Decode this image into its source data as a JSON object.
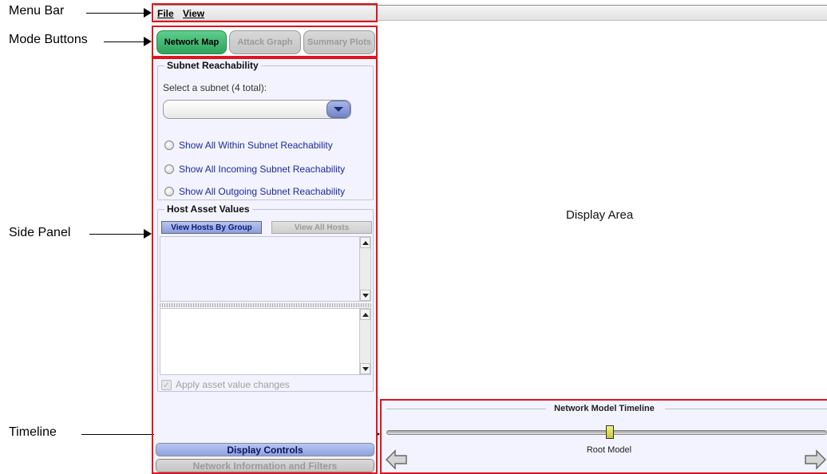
{
  "annotations": {
    "menu_bar": "Menu Bar",
    "mode_buttons": "Mode Buttons",
    "side_panel": "Side Panel",
    "timeline": "Timeline",
    "display_area": "Display Area"
  },
  "menu": {
    "file": "File",
    "view": "View"
  },
  "modes": {
    "network_map": "Network Map",
    "attack_graph": "Attack Graph",
    "summary_plots": "Summary Plots"
  },
  "subnet": {
    "title": "Subnet Reachability",
    "select_label": "Select a subnet (4 total):",
    "selected_value": "",
    "options": [
      "Show All Within Subnet Reachability",
      "Show All Incoming Subnet Reachability",
      "Show All Outgoing Subnet Reachability"
    ]
  },
  "host_assets": {
    "title": "Host Asset Values",
    "view_by_group": "View Hosts By Group",
    "view_all": "View All Hosts",
    "apply_label": "Apply asset value changes"
  },
  "side_buttons": {
    "display_controls": "Display Controls",
    "network_info": "Network Information and Filters"
  },
  "timeline": {
    "title": "Network Model Timeline",
    "current_model": "Root Model"
  },
  "colors": {
    "annotation_box": "#e0141e",
    "mode_active": "#2fa35d",
    "panel_bg": "#f3f3ff",
    "link_text": "#1a2aa0"
  }
}
